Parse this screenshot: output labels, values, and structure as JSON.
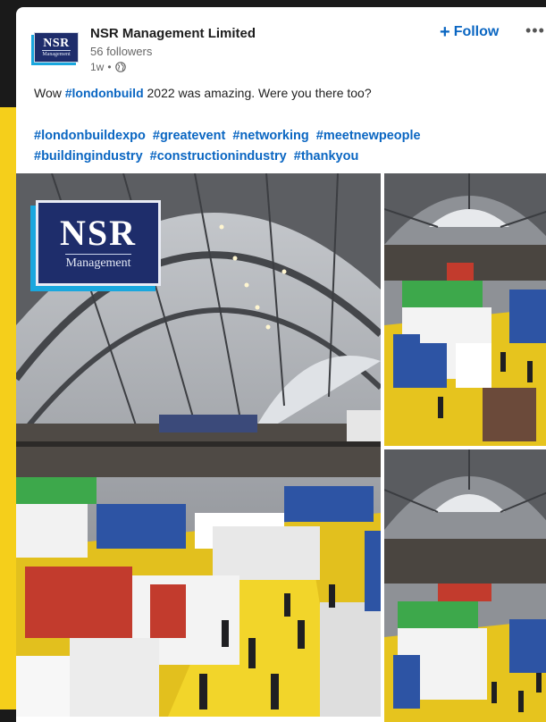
{
  "post": {
    "company_name": "NSR Management Limited",
    "followers": "56 followers",
    "time_ago": "1w",
    "follow_label": "Follow",
    "more_icon": "more-horizontal-icon",
    "text_prefix": "Wow ",
    "text_hashtag": "#londonbuild",
    "text_suffix": " 2022 was amazing. Were you there too?",
    "hashtags": [
      "#londonbuildexpo",
      "#greatevent",
      "#networking",
      "#meetnewpeople",
      "#buildingindustry",
      "#constructionindustry",
      "#thankyou"
    ]
  },
  "logo": {
    "main": "NSR",
    "sub": "Management"
  },
  "colors": {
    "accent": "#0a66c2",
    "brand_navy": "#1e2d6b",
    "brand_cyan": "#19a7de",
    "highlight_yellow": "#f5cf1b"
  }
}
